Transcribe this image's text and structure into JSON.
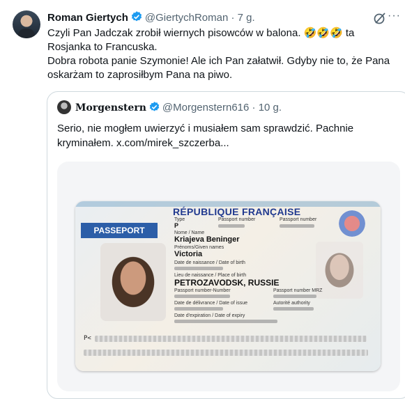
{
  "tweet": {
    "author_name": "Roman Giertych",
    "handle": "@GiertychRoman",
    "time": "· 7 g.",
    "line1": "Czyli Pan Jadczak zrobił wiernych pisowców w balona. 🤣🤣🤣 ta",
    "line2": "Rosjanka to Francuska.",
    "line3": "Dobra robota panie Szymonie! Ale ich Pan załatwił. Gdyby nie to, że Pana",
    "line4": "oskarżam to zaprosiłbym Pana na piwo.",
    "more": "···"
  },
  "quote": {
    "author_name": "Morgenstern",
    "handle": "@Morgenstern616",
    "time": "· 10 g.",
    "line1": "Serio, nie mogłem uwierzyć i musiałem sam sprawdzić. Pachnie",
    "line2": "kryminałem.  x.com/mirek_szczerba..."
  },
  "passport": {
    "country": "RÉPUBLIQUE FRANÇAISE",
    "doc_title": "PASSEPORT",
    "type_label": "Type",
    "type_value": "P",
    "passport_number_label": "Passport number",
    "passport_number_label2": "Passport number",
    "surname_label": "Nome / Name",
    "surname": "Kriajeva Beninger",
    "given_label": "Prénoms/Given names",
    "given": "Victoria",
    "dob_label": "Date de naissance / Date of birth",
    "pob_label": "Lieu de naissance / Place of birth",
    "pob": "PETROZAVODSK, RUSSIE",
    "number_label": "Passport number-Number",
    "mrz_label": "Passport number MRZ",
    "issue_label": "Date de délivrance / Date of issue",
    "authority_label": "Autorité authority",
    "expiry_label": "Date d'expiration / Date of expiry",
    "mrz_prefix": "P<"
  },
  "colors": {
    "verified": "#1d9bf0",
    "passport_blue": "#2c5ea8",
    "muted": "#536471"
  }
}
